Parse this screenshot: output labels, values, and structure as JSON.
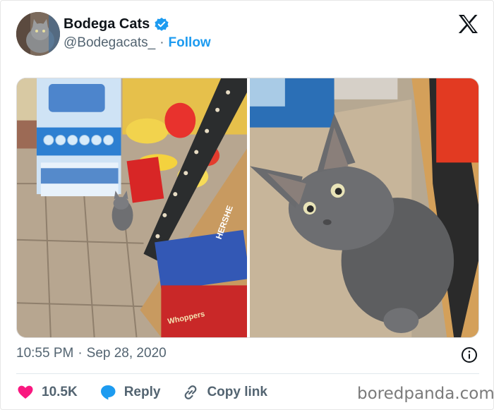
{
  "header": {
    "display_name": "Bodega Cats",
    "handle": "@Bodegacats_",
    "separator": "·",
    "follow_label": "Follow"
  },
  "media": {
    "left_photo_alt": "Kitten beside water bottle packs and candy shelf",
    "right_photo_alt": "Close-up of grey kitten peeking from shelf"
  },
  "shelf_text": {
    "brand_sign": "HERSHE",
    "candy_label": "Whoppers"
  },
  "meta": {
    "time": "10:55 PM",
    "separator": "·",
    "date": "Sep 28, 2020"
  },
  "actions": {
    "likes": "10.5K",
    "reply_label": "Reply",
    "copy_label": "Copy link"
  },
  "watermark": "boredpanda.com",
  "colors": {
    "accent": "#1d9bf0",
    "like": "#f91880",
    "text_secondary": "#536471"
  },
  "icons": [
    "verified-badge-icon",
    "x-logo-icon",
    "info-icon",
    "heart-icon",
    "reply-icon",
    "link-icon"
  ]
}
